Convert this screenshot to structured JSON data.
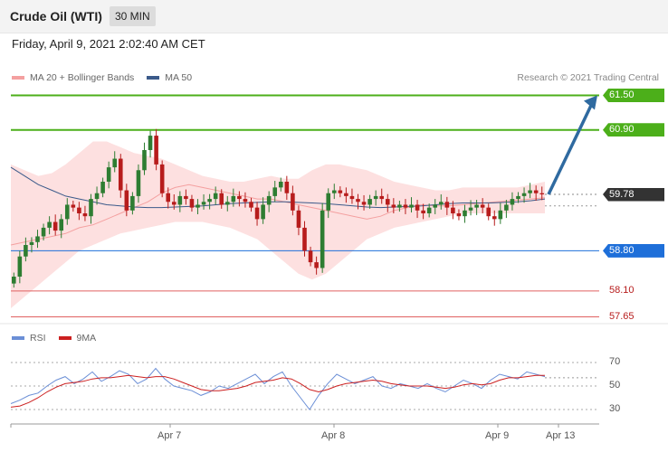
{
  "header": {
    "title": "Crude Oil (WTI)",
    "timeframe": "30 MIN",
    "datetime": "Friday, April 9, 2021 2:02:40 AM CET"
  },
  "legend": {
    "ma20_label": "MA 20 + Bollinger Bands",
    "ma50_label": "MA 50",
    "rsi_label": "RSI",
    "rsi_ma_label": "9MA",
    "copyright": "Research © 2021 Trading Central"
  },
  "colors": {
    "bull": "#2e7d32",
    "bear": "#b71c1c",
    "resistance": "#4caf1a",
    "support_blue": "#1e6fd9",
    "support_red": "#e06060",
    "band_fill": "#fde0e0",
    "ma20": "#f4a0a0",
    "ma50": "#3b5a8a",
    "rsi": "#6b8fd6",
    "rsi_ma": "#cc2020",
    "arrow": "#2f6aa0"
  },
  "chart_data": [
    {
      "type": "candlestick",
      "symbol": "Crude Oil (WTI)",
      "timeframe": "30 MIN",
      "x_ticks": [
        "Apr 7",
        "Apr 8",
        "Apr 9",
        "Apr 13"
      ],
      "ylim": [
        57.58,
        61.65
      ],
      "y_ticks": [],
      "current_price": 59.78,
      "levels": [
        {
          "value": 61.5,
          "label": "61.50",
          "style": "resistance",
          "tag": true
        },
        {
          "value": 60.9,
          "label": "60.90",
          "style": "resistance",
          "tag": true
        },
        {
          "value": 59.78,
          "label": "59.78",
          "style": "current",
          "tag": true
        },
        {
          "value": 58.8,
          "label": "58.80",
          "style": "support_blue",
          "tag": true
        },
        {
          "value": 58.1,
          "label": "58.10",
          "style": "support_red",
          "tag": false
        },
        {
          "value": 57.65,
          "label": "57.65",
          "style": "support_red",
          "tag": false
        }
      ],
      "arrow": {
        "from": 59.78,
        "to": 61.5
      },
      "close": [
        58.35,
        58.7,
        58.9,
        58.95,
        59.05,
        59.2,
        59.3,
        59.15,
        59.35,
        59.6,
        59.55,
        59.45,
        59.4,
        59.7,
        59.8,
        60.0,
        60.25,
        60.4,
        59.85,
        59.5,
        59.75,
        60.2,
        60.55,
        60.8,
        60.3,
        59.8,
        59.65,
        59.6,
        59.75,
        59.7,
        59.55,
        59.6,
        59.65,
        59.7,
        59.8,
        59.6,
        59.65,
        59.75,
        59.7,
        59.65,
        59.55,
        59.35,
        59.6,
        59.75,
        59.9,
        60.0,
        59.8,
        59.5,
        59.2,
        58.8,
        58.6,
        58.5,
        59.5,
        59.8,
        59.85,
        59.8,
        59.75,
        59.7,
        59.65,
        59.6,
        59.7,
        59.75,
        59.7,
        59.6,
        59.55,
        59.6,
        59.55,
        59.6,
        59.5,
        59.45,
        59.55,
        59.6,
        59.65,
        59.55,
        59.45,
        59.4,
        59.5,
        59.55,
        59.6,
        59.55,
        59.4,
        59.35,
        59.5,
        59.6,
        59.7,
        59.75,
        59.8,
        59.85,
        59.8,
        59.78
      ],
      "series_lines": [
        {
          "name": "MA 20 + Bollinger Bands",
          "mid": [
            58.9,
            58.95,
            59.0,
            59.05,
            59.1,
            59.2,
            59.25,
            59.35,
            59.45,
            59.55,
            59.65,
            59.8,
            59.9,
            59.95,
            59.9,
            59.85,
            59.8,
            59.75,
            59.7,
            59.7,
            59.65,
            59.6,
            59.55,
            59.5,
            59.45,
            59.4,
            59.35,
            59.4,
            59.5,
            59.55,
            59.6,
            59.58,
            59.58,
            59.6,
            59.62,
            59.64,
            59.66,
            59.68,
            59.7,
            59.72
          ],
          "upper": [
            60.3,
            60.2,
            60.1,
            60.15,
            60.3,
            60.5,
            60.7,
            60.7,
            60.6,
            60.5,
            60.45,
            60.4,
            60.3,
            60.2,
            60.1,
            60.05,
            60.0,
            60.0,
            60.05,
            60.1,
            60.05,
            60.05,
            60.2,
            60.3,
            60.3,
            60.25,
            60.2,
            60.1,
            60.0,
            59.95,
            59.9,
            59.85,
            59.85,
            59.9,
            59.9,
            59.9,
            59.9,
            59.9,
            59.95,
            60.0
          ],
          "lower": [
            57.8,
            58.0,
            58.2,
            58.4,
            58.6,
            58.8,
            58.9,
            59.0,
            59.1,
            59.15,
            59.2,
            59.25,
            59.3,
            59.3,
            59.3,
            59.25,
            59.2,
            59.1,
            59.0,
            58.8,
            58.6,
            58.4,
            58.3,
            58.4,
            58.6,
            58.8,
            59.0,
            59.1,
            59.2,
            59.25,
            59.3,
            59.35,
            59.4,
            59.45,
            59.45,
            59.45,
            59.45,
            59.45,
            59.45,
            59.45
          ]
        },
        {
          "name": "MA 50",
          "values": [
            60.25,
            60.1,
            59.95,
            59.85,
            59.75,
            59.7,
            59.65,
            59.6,
            59.58,
            59.56,
            59.55,
            59.55,
            59.56,
            59.57,
            59.58,
            59.6,
            59.62,
            59.63,
            59.64,
            59.65,
            59.65,
            59.64,
            59.63,
            59.62,
            59.6,
            59.58,
            59.56,
            59.55,
            59.56,
            59.57,
            59.58,
            59.6,
            59.62,
            59.63,
            59.63,
            59.63,
            59.64,
            59.65,
            59.67,
            59.7
          ]
        }
      ]
    },
    {
      "type": "line",
      "series": [
        {
          "name": "RSI",
          "values": [
            35,
            38,
            42,
            44,
            50,
            55,
            58,
            52,
            56,
            62,
            54,
            58,
            63,
            60,
            52,
            56,
            65,
            56,
            50,
            48,
            46,
            42,
            45,
            50,
            48,
            52,
            56,
            60,
            52,
            58,
            62,
            50,
            40,
            30,
            42,
            52,
            60,
            56,
            52,
            55,
            58,
            50,
            48,
            52,
            50,
            48,
            52,
            48,
            45,
            50,
            55,
            52,
            48,
            55,
            60,
            58,
            56,
            62,
            60,
            58
          ]
        },
        {
          "name": "9MA",
          "values": [
            32,
            33,
            36,
            40,
            45,
            49,
            52,
            53,
            54,
            56,
            57,
            57,
            58,
            59,
            58,
            57,
            58,
            58,
            56,
            53,
            50,
            47,
            46,
            46,
            47,
            48,
            50,
            53,
            54,
            55,
            57,
            56,
            52,
            47,
            45,
            47,
            50,
            52,
            53,
            54,
            55,
            54,
            52,
            51,
            50,
            50,
            50,
            49,
            48,
            49,
            51,
            52,
            51,
            52,
            55,
            57,
            57,
            58,
            59,
            59
          ]
        }
      ],
      "y_ticks": [
        30,
        50,
        70
      ],
      "ylim": [
        20,
        80
      ],
      "levels": [
        57
      ]
    }
  ]
}
